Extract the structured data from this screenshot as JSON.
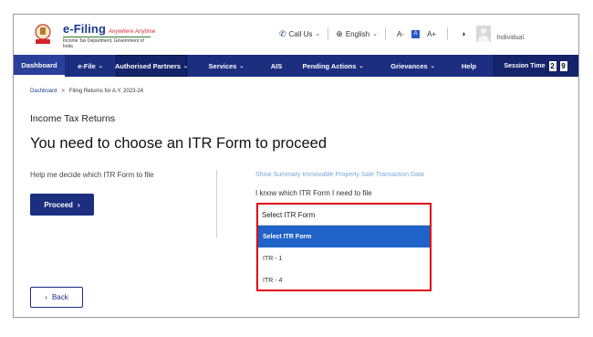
{
  "header": {
    "brand_title": "e-Filing",
    "brand_tagline": "Anywhere Anytime",
    "brand_subtitle": "Income Tax Department, Government of India",
    "call_us": "Call Us",
    "language": "English",
    "font_decrease": "A-",
    "font_normal": "A",
    "font_increase": "A+",
    "user_type": "Individual"
  },
  "nav": {
    "items": [
      {
        "label": "Dashboard"
      },
      {
        "label": "e-File",
        "chevron": "⌄"
      },
      {
        "label": "Authorised Partners",
        "chevron": "⌄"
      },
      {
        "label": "Services",
        "chevron": "⌄"
      },
      {
        "label": "AIS"
      },
      {
        "label": "Pending Actions",
        "chevron": "⌄"
      },
      {
        "label": "Grievances",
        "chevron": "⌄"
      },
      {
        "label": "Help"
      }
    ],
    "session_label": "Session Time",
    "session_digits": [
      "2",
      "9"
    ]
  },
  "breadcrumb": {
    "home": "Dashboard",
    "separator": ">",
    "current": "Filing Returns for A.Y. 2023-24"
  },
  "main": {
    "section_title": "Income Tax Returns",
    "heading": "You need to choose an ITR Form to proceed",
    "help_text": "Help me decide which ITR Form to file",
    "proceed_label": "Proceed",
    "proceed_arrow": "›",
    "summary_link": "Show Summary Immovable Property Sale Transaction Data",
    "know_label": "I know which ITR Form I need to file",
    "back_label": "Back",
    "back_arrow": "‹"
  },
  "itr_dropdown": {
    "placeholder": "Select ITR Form",
    "options": [
      "Select ITR Form",
      "ITR - 1",
      "ITR - 4"
    ],
    "highlighted_index": 0
  },
  "colors": {
    "nav_bg": "#1b2e80",
    "highlight": "#1f62c8",
    "annotation_border": "#e0000c"
  }
}
